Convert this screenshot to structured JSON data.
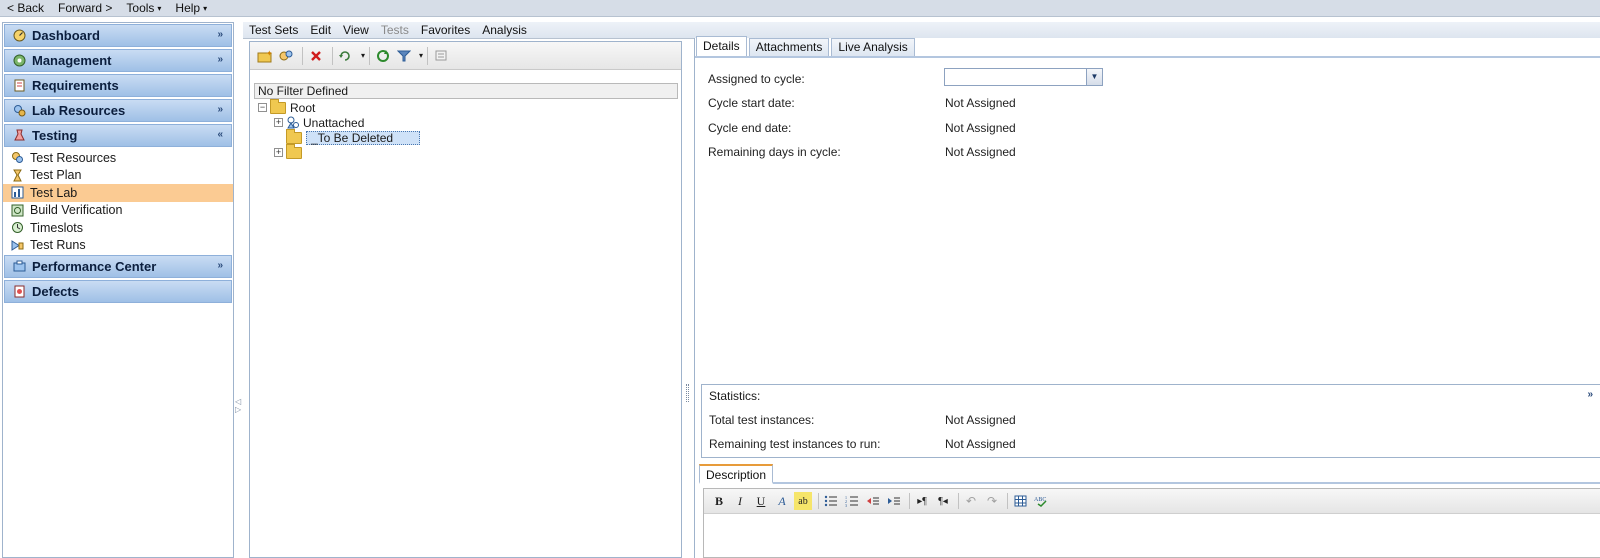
{
  "topbar": {
    "back": "< Back",
    "forward": "Forward >",
    "tools": "Tools",
    "help": "Help"
  },
  "nav": {
    "sections": {
      "dashboard": "Dashboard",
      "management": "Management",
      "requirements": "Requirements",
      "lab_resources": "Lab Resources",
      "testing": "Testing",
      "performance_center": "Performance Center",
      "defects": "Defects"
    },
    "testing_items": [
      {
        "label": "Test Resources"
      },
      {
        "label": "Test Plan"
      },
      {
        "label": "Test Lab"
      },
      {
        "label": "Build Verification"
      },
      {
        "label": "Timeslots"
      },
      {
        "label": "Test Runs"
      }
    ],
    "selected": "Test Lab"
  },
  "menu": {
    "test_sets": "Test Sets",
    "edit": "Edit",
    "view": "View",
    "tests": "Tests",
    "favorites": "Favorites",
    "analysis": "Analysis"
  },
  "tree": {
    "filter": "No Filter Defined",
    "root": "Root",
    "unattached": "Unattached",
    "to_be_deleted": "_To Be Deleted"
  },
  "details": {
    "tabs": {
      "details": "Details",
      "attachments": "Attachments",
      "live_analysis": "Live Analysis"
    },
    "fields": {
      "assigned_to_cycle": "Assigned to cycle:",
      "cycle_start": "Cycle start date:",
      "cycle_start_value": "Not Assigned",
      "cycle_end": "Cycle end date:",
      "cycle_end_value": "Not Assigned",
      "remaining_days": "Remaining days in cycle:",
      "remaining_days_value": "Not Assigned"
    },
    "statistics": {
      "title": "Statistics:",
      "total_label": "Total test instances:",
      "total_value": "Not Assigned",
      "remaining_label": "Remaining test instances to run:",
      "remaining_value": "Not Assigned"
    },
    "description_tab": "Description"
  },
  "colors": {
    "nav_header": "#9fc0e6",
    "nav_selected": "#fbcb93",
    "tab_accent": "#e79b3a"
  }
}
